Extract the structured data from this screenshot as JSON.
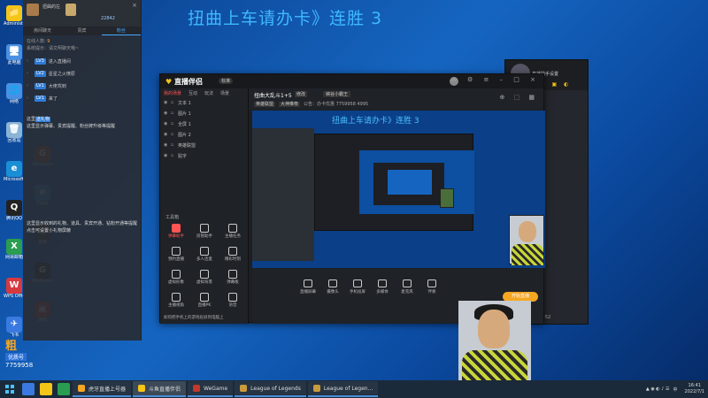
{
  "overlay_title": "扭曲上车请办卡》连胜 3",
  "desktop": {
    "icons_col1": [
      {
        "label": "Administrator",
        "color": "#f5c518",
        "glyph": "📁"
      },
      {
        "label": "此电脑",
        "color": "#4a90e2",
        "glyph": "🖥"
      },
      {
        "label": "网络",
        "color": "#4a90e2",
        "glyph": "🌐"
      },
      {
        "label": "回收站",
        "color": "#8ab4d6",
        "glyph": "🗑"
      },
      {
        "label": "Microsoft Edge",
        "color": "#1a8fd6",
        "glyph": "e"
      },
      {
        "label": "腾讯QQ",
        "color": "#222",
        "glyph": "Q"
      },
      {
        "label": "网易邮箱",
        "color": "#2a9d50",
        "glyph": "X"
      },
      {
        "label": "WPS Office",
        "color": "#d6393f",
        "glyph": "W"
      },
      {
        "label": "飞书",
        "color": "#3a7ae0",
        "glyph": "✈"
      }
    ],
    "icons_col2": [
      {
        "label": "WeGame",
        "color": "#a0522d",
        "glyph": "G"
      },
      {
        "label": "Edge",
        "color": "#1a8fd6",
        "glyph": "e"
      },
      {
        "label": "直播",
        "color": "#333",
        "glyph": "◎"
      },
      {
        "label": "WeGame",
        "color": "#222",
        "glyph": "G"
      },
      {
        "label": "游戏",
        "color": "#c0392b",
        "glyph": "▣"
      }
    ]
  },
  "chat": {
    "user_name": "扭曲的左",
    "count": "22842",
    "tabs": [
      "房间聊天",
      "贵宾",
      "粉丝"
    ],
    "sys_line1": "在线人数:",
    "sys_hl": "9",
    "sys_line2": "系统提示：请文明聊天哦~",
    "rows": [
      {
        "badge": "LV3",
        "text": "进入直播间"
      },
      {
        "badge": "LV2",
        "text": "星星之火燎原"
      },
      {
        "badge": "LV1",
        "text": "大佬驾到"
      },
      {
        "badge": "LV1",
        "text": "来了"
      }
    ],
    "note1": "送礼物",
    "note2": "这里显示弹幕、贵宾提醒、粉丝牌升级等提醒",
    "note3": "这里显示收到的礼物、道具、贵宾开通、钻粉开通等提醒",
    "note4": "点击可设置小礼物屏蔽"
  },
  "broadcaster": {
    "logo": "直播伴侣",
    "version": "标准",
    "left_tabs": [
      "我的场景",
      "互动",
      "玩法",
      "场景"
    ],
    "scenes": [
      "文本 1",
      "图片 1",
      "全屏 1",
      "图片 2",
      "英雄联盟",
      "贴字"
    ],
    "tools_title": "工具箱",
    "tools": [
      {
        "label": "弹幕助手",
        "red": true
      },
      {
        "label": "房管助手",
        "red": false
      },
      {
        "label": "主播任务",
        "red": false
      },
      {
        "label": "预约直播",
        "red": false
      },
      {
        "label": "多人连麦",
        "red": false
      },
      {
        "label": "精彩时刻",
        "red": false
      },
      {
        "label": "虚拟形象",
        "red": false
      },
      {
        "label": "虚拟背景",
        "red": false
      },
      {
        "label": "弹幕板",
        "red": false
      },
      {
        "label": "主播视角",
        "red": false
      },
      {
        "label": "直播PK",
        "red": false
      },
      {
        "label": "语音",
        "red": false
      }
    ],
    "bottom_hint": "如何把手机上的游戏投屏到电脑上",
    "stream_title": "扭曲大乱斗1+5",
    "badge1": "修改",
    "badge2": "峡谷小霸王",
    "sub_tags": [
      "英雄联盟",
      "大神推荐"
    ],
    "sub_info": "公告：办卡优惠   7759958   4995",
    "preview_title": "扭曲上车请办卡》连胜 3",
    "controls": [
      {
        "label": "直播屏幕"
      },
      {
        "label": "摄像头"
      },
      {
        "label": "手机投屏"
      },
      {
        "label": "多媒体"
      },
      {
        "label": "麦克风"
      },
      {
        "label": "伴奏"
      }
    ],
    "start_label": "开始直播"
  },
  "right_window": {
    "name": "直播助手设置",
    "footer": "9:52"
  },
  "watermark": {
    "logo": "粗",
    "badge": "优质号",
    "number": "7759958"
  },
  "taskbar": {
    "apps": [
      {
        "label": "虎牙直播上号器",
        "color": "#f5a623",
        "active": false
      },
      {
        "label": "斗鱼直播伴侣",
        "color": "#f5c518",
        "active": true
      },
      {
        "label": "WeGame",
        "color": "#c0392b",
        "active": false
      },
      {
        "label": "League of Legends",
        "color": "#c89b3c",
        "active": false
      },
      {
        "label": "League of Legen...",
        "color": "#c89b3c",
        "active": false
      }
    ],
    "time": "16:41",
    "date": "2022/7/1",
    "lang": "中"
  }
}
